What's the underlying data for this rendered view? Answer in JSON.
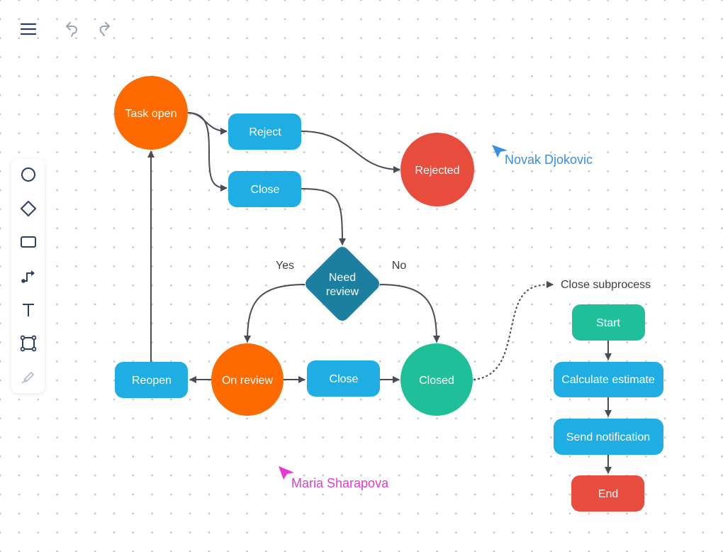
{
  "topbar": {
    "menu_icon": "hamburger-menu-icon",
    "undo_icon": "undo-icon",
    "redo_icon": "redo-icon"
  },
  "toolbar": {
    "tools": [
      {
        "name": "circle-tool",
        "icon": "circle-icon"
      },
      {
        "name": "diamond-tool",
        "icon": "diamond-icon"
      },
      {
        "name": "rectangle-tool",
        "icon": "rectangle-icon"
      },
      {
        "name": "connector-tool",
        "icon": "connector-icon"
      },
      {
        "name": "text-tool",
        "icon": "text-icon"
      },
      {
        "name": "frame-tool",
        "icon": "frame-icon"
      },
      {
        "name": "pen-tool",
        "icon": "pencil-icon",
        "disabled": true
      }
    ]
  },
  "colors": {
    "orange": "#ff6a00",
    "blue": "#1eaee4",
    "red": "#e74c3c",
    "green": "#1fbf99",
    "teal": "#1d7fa0",
    "connector": "#474c55",
    "cursor_novak": "#3b8fe0",
    "cursor_maria": "#e23ad3"
  },
  "diagram": {
    "nodes": {
      "task_open": "Task open",
      "reject": "Reject",
      "close_top": "Close",
      "rejected": "Rejected",
      "need_review_1": "Need",
      "need_review_2": "review",
      "reopen": "Reopen",
      "on_review": "On review",
      "close_bottom": "Close",
      "closed": "Closed",
      "start": "Start",
      "calculate_estimate": "Calculate estimate",
      "send_notification": "Send notification",
      "end": "End"
    },
    "labels": {
      "yes": "Yes",
      "no": "No",
      "close_subprocess": "Close subprocess"
    }
  },
  "collaborators": [
    {
      "name": "Novak Djokovic"
    },
    {
      "name": "Maria Sharapova"
    }
  ]
}
